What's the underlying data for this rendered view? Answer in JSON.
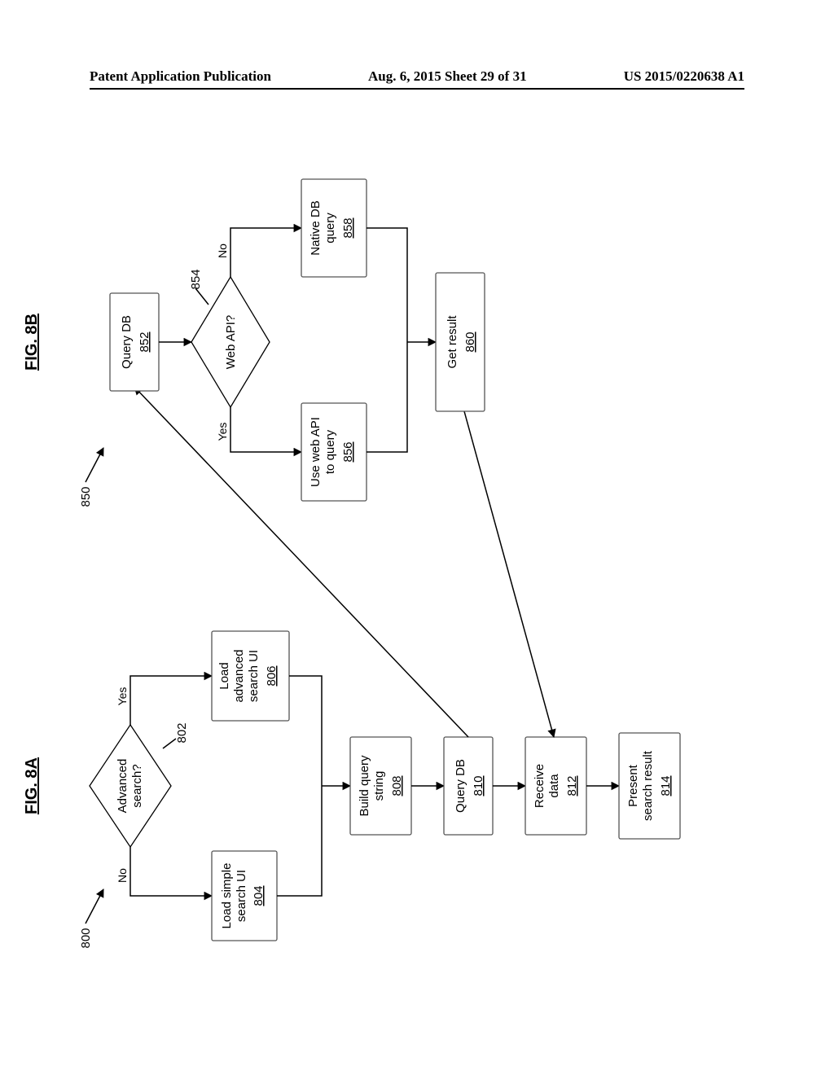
{
  "header": {
    "left": "Patent Application Publication",
    "center": "Aug. 6, 2015  Sheet 29 of 31",
    "right": "US 2015/0220638 A1"
  },
  "fig8a": {
    "title": "FIG. 8A",
    "ref": "800",
    "decision": {
      "line1": "Advanced",
      "line2": "search?",
      "refnum": "802",
      "yes": "Yes",
      "no": "No"
    },
    "boxes": {
      "simpleUI": {
        "line1": "Load simple",
        "line2": "search UI",
        "refnum": "804"
      },
      "advUI": {
        "line1": "Load",
        "line2": "advanced",
        "line3": "search UI",
        "refnum": "806"
      },
      "build": {
        "line1": "Build query",
        "line2": "string",
        "refnum": "808"
      },
      "queryDB": {
        "line1": "Query DB",
        "refnum": "810"
      },
      "receive": {
        "line1": "Receive",
        "line2": "data",
        "refnum": "812"
      },
      "present": {
        "line1": "Present",
        "line2": "search result",
        "refnum": "814"
      }
    }
  },
  "fig8b": {
    "title": "FIG. 8B",
    "ref": "850",
    "queryDB": {
      "line1": "Query DB",
      "refnum": "852"
    },
    "decision": {
      "line1": "Web API?",
      "refnum": "854",
      "yes": "Yes",
      "no": "No"
    },
    "useWeb": {
      "line1": "Use web API",
      "line2": "to query",
      "refnum": "856"
    },
    "nativeDB": {
      "line1": "Native DB",
      "line2": "query",
      "refnum": "858"
    },
    "getResult": {
      "line1": "Get result",
      "refnum": "860"
    }
  }
}
